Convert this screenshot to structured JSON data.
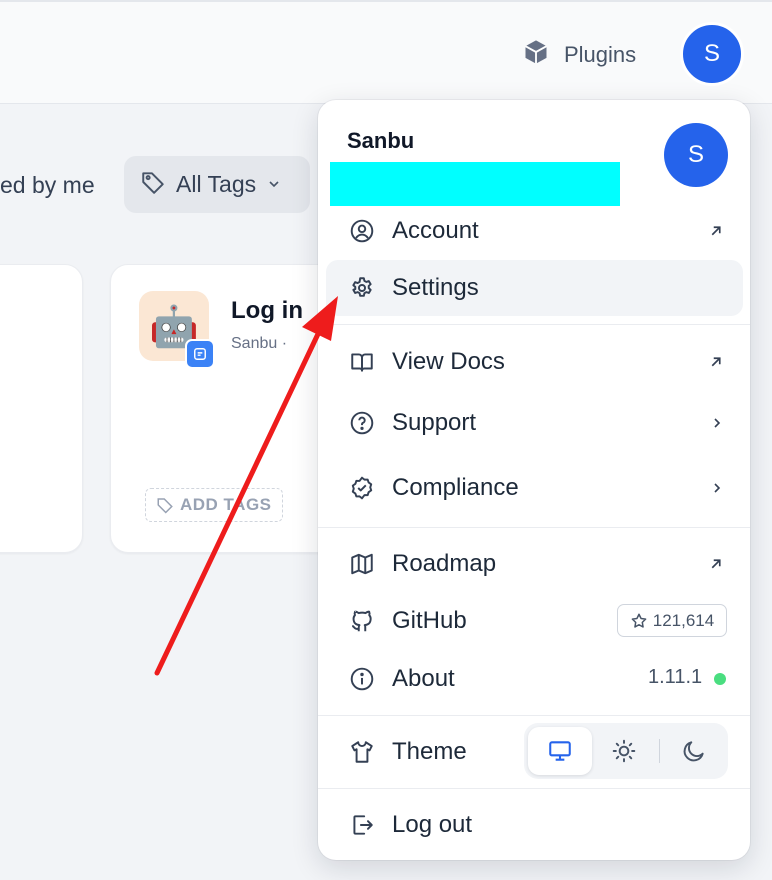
{
  "header": {
    "plugins_label": "Plugins",
    "avatar_initial": "S"
  },
  "toolbar": {
    "filter_partial": "ed by me",
    "tags_label": "All Tags"
  },
  "card": {
    "title": "Log in",
    "author": "Sanbu ·",
    "add_tags": "ADD TAGS",
    "icon_emoji": "🤖"
  },
  "menu": {
    "user_name": "Sanbu",
    "avatar_initial": "S",
    "items": [
      {
        "label": "Account"
      },
      {
        "label": "Settings"
      },
      {
        "label": "View Docs"
      },
      {
        "label": "Support"
      },
      {
        "label": "Compliance"
      },
      {
        "label": "Roadmap"
      },
      {
        "label": "GitHub"
      },
      {
        "label": "About"
      },
      {
        "label": "Theme"
      },
      {
        "label": "Log out"
      }
    ],
    "github_stars": "121,614",
    "version": "1.11.1"
  },
  "colors": {
    "accent": "#2563eb",
    "arrow": "#ee1c1c",
    "redaction": "#00ffff",
    "status_ok": "#4ade80"
  },
  "icons": {
    "account": "user-circle-icon",
    "settings": "gear-icon",
    "docs": "book-icon",
    "support": "help-circle-icon",
    "compliance": "shield-check-icon",
    "roadmap": "map-icon",
    "github": "github-icon",
    "about": "info-icon",
    "theme": "shirt-icon",
    "logout": "logout-icon"
  }
}
